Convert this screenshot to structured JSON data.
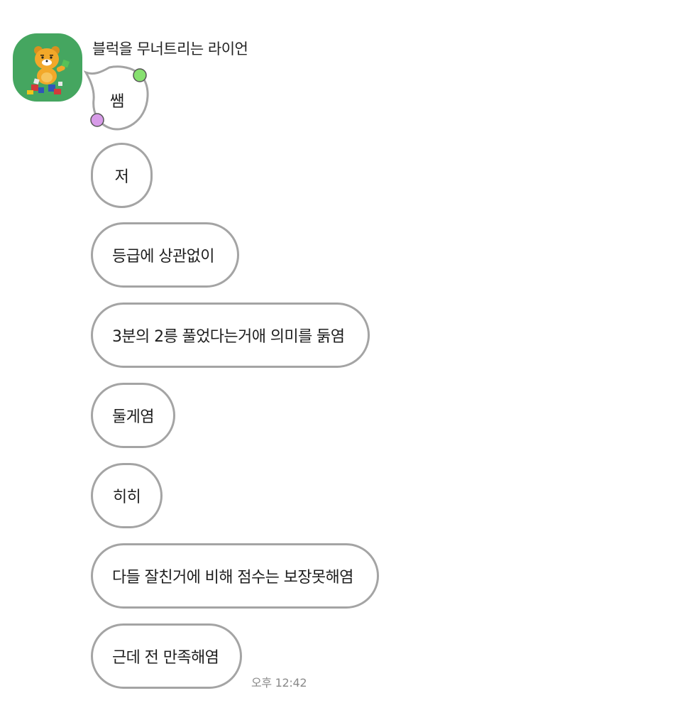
{
  "chat": {
    "sender_name": "블럭을 무너트리는 라이언",
    "avatar_icon": "ryan-character-icon",
    "bubble_border_color": "#a4a4a4",
    "avatar_background": "#45a660",
    "messages": [
      "쌤",
      "저",
      "등급에 상관없이",
      "3분의 2릉 풀었다는거애 의미를 둙염",
      "둘게염",
      "히히",
      "다들 잘친거에 비해 점수는 보장못해염",
      "근데 전 만족해염"
    ],
    "timestamp": "오후 12:42"
  }
}
